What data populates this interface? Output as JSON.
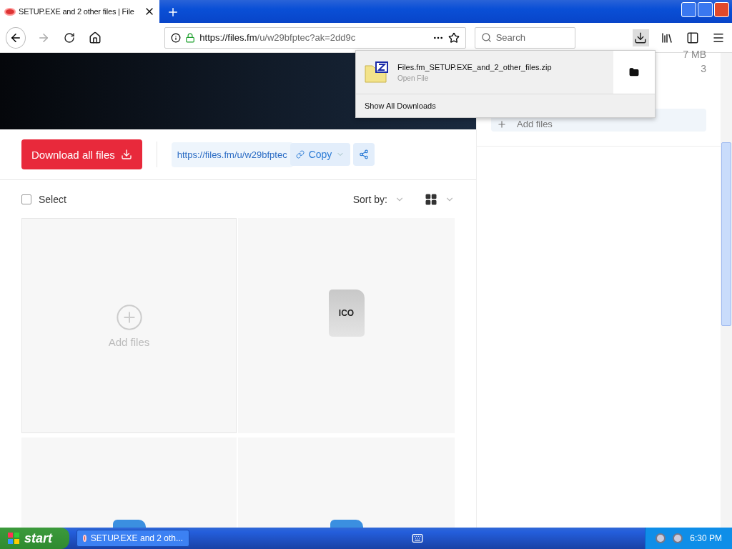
{
  "browser": {
    "tab": {
      "title": "SETUP.EXE and 2 other files | File"
    },
    "address": {
      "url_host": "https://files.fm",
      "url_path": "/u/w29bfptec?ak=2dd9c"
    },
    "search": {
      "placeholder": "Search"
    }
  },
  "downloads_panel": {
    "items": [
      {
        "filename": "Files.fm_SETUP.EXE_and_2_other_files.zip",
        "status": "Open File"
      }
    ],
    "show_all": "Show All Downloads"
  },
  "page": {
    "actions": {
      "download_button": "Download all files",
      "share_url": "https://files.fm/u/w29bfptec",
      "copy_button": "Copy"
    },
    "toolbar": {
      "select_label": "Select",
      "select_checked": false,
      "sort_label": "Sort by:"
    },
    "files": [
      {
        "kind": "add",
        "label": "Add files"
      },
      {
        "kind": "file",
        "ext": "ICO"
      },
      {
        "kind": "partial"
      },
      {
        "kind": "partial"
      }
    ]
  },
  "sidebar": {
    "size": "7 MB",
    "count": "3",
    "add_files": "Add files"
  },
  "taskbar": {
    "start": "start",
    "tasks": [
      {
        "label": "SETUP.EXE and 2 oth...",
        "selected": false
      }
    ],
    "clock": "6:30 PM"
  }
}
